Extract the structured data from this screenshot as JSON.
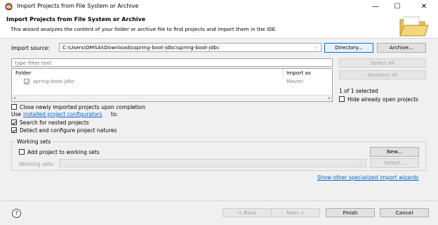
{
  "window": {
    "title": "Import Projects from File System or Archive",
    "minimize_glyph": "—",
    "maximize_glyph": "☐",
    "close_glyph": "✕"
  },
  "header": {
    "title": "Import Projects from File System or Archive",
    "description": "This wizard analyzes the content of your folder or archive file to find projects and import them in the IDE."
  },
  "import_source": {
    "label": "Import source:",
    "value": "C:\\Users\\OMSAI\\Downloads\\spring-boot-jdbc\\spring-boot-jdbc",
    "directory_button": "Directory...",
    "archive_button": "Archive..."
  },
  "filter": {
    "placeholder": "type filter text"
  },
  "table": {
    "columns": [
      "Folder",
      "Import as"
    ],
    "rows": [
      {
        "folder": "spring-boot-jdbc",
        "import_as": "Maven",
        "checked": true
      }
    ]
  },
  "side_buttons": {
    "select_all": "Select All",
    "deselect_all": "Deselect All",
    "selection_count": "1 of 1 selected",
    "hide_open_label": "Hide already open projects"
  },
  "options": {
    "close_newly_imported": "Close newly imported projects upon completion",
    "use_prefix": "Use",
    "use_link": "installed project configurators",
    "use_suffix": "to:",
    "search_nested": "Search for nested projects",
    "detect_configure": "Detect and configure project natures"
  },
  "working_sets": {
    "group_title": "Working sets",
    "add_label": "Add project to working sets",
    "new_button": "New...",
    "field_label": "Working sets:",
    "select_button": "Select..."
  },
  "specialized_link": "Show other specialized import wizards",
  "footer": {
    "help_glyph": "?",
    "back": "< Back",
    "next": "Next >",
    "finish": "Finish",
    "cancel": "Cancel"
  },
  "colors": {
    "link": "#0066cc",
    "focus_border": "#0078d7"
  }
}
